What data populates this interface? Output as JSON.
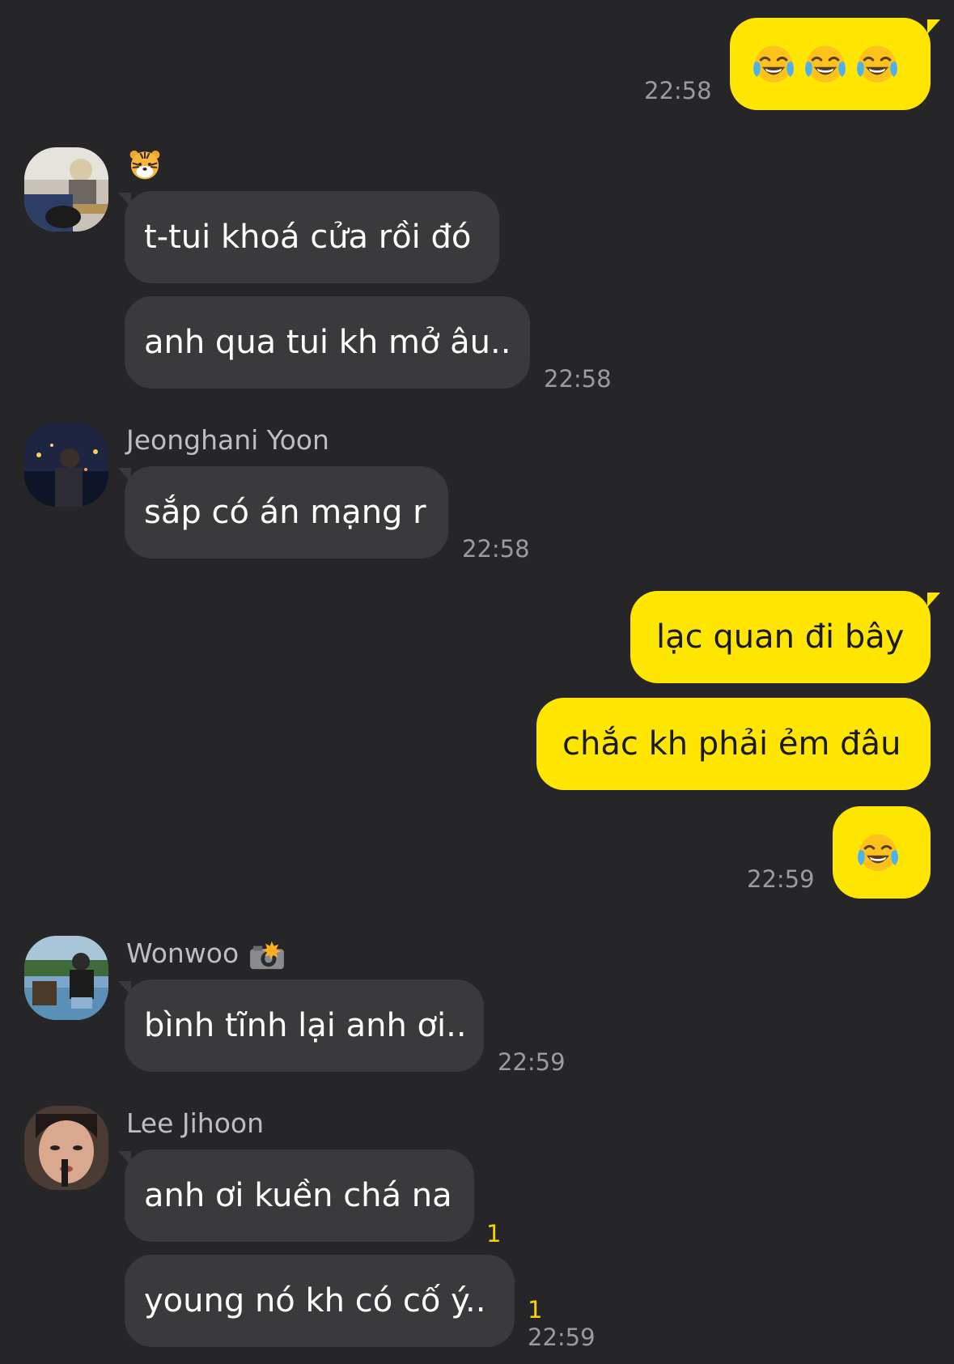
{
  "chat": {
    "m1": {
      "emoji": [
        "face-with-tears-of-joy-icon",
        "face-with-tears-of-joy-icon",
        "face-with-tears-of-joy-icon"
      ],
      "time": "22:58"
    },
    "g1": {
      "sender_emoji": "tiger-face-icon",
      "messages": [
        "t-tui khoá cửa rồi đó",
        "anh qua tui kh mở âu.."
      ],
      "time": "22:58"
    },
    "g2": {
      "sender": "Jeonghani Yoon",
      "messages": [
        "sắp có án mạng r"
      ],
      "time": "22:58"
    },
    "m2": {
      "messages": [
        "lạc quan đi bây",
        "chắc kh phải ẻm đâu"
      ],
      "emoji": [
        "face-with-tears-of-joy-icon"
      ],
      "time": "22:59"
    },
    "g3": {
      "sender": "Wonwoo",
      "sender_emoji": "camera-with-flash-icon",
      "messages": [
        "bình tĩnh lại anh ơi.."
      ],
      "time": "22:59"
    },
    "g4": {
      "sender": "Lee Jihoon",
      "messages": [
        "anh ơi kuền chá na",
        "young nó kh có cố ý.."
      ],
      "unread": [
        "1",
        "1"
      ],
      "time": "22:59"
    }
  },
  "colors": {
    "background": "#262628",
    "bubble_in": "#3a3a3c",
    "bubble_out": "#ffe600",
    "unread": "#f5d400"
  }
}
